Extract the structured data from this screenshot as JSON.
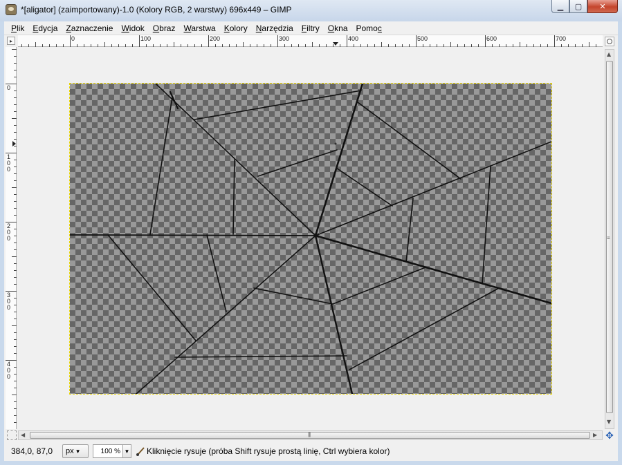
{
  "window": {
    "title": "*[aligator] (zaimportowany)-1.0 (Kolory RGB, 2 warstwy) 696x449 – GIMP",
    "buttons": {
      "minimize": "▁",
      "maximize": "▢",
      "close": "✕"
    }
  },
  "menu": [
    {
      "key": "P",
      "rest": "lik"
    },
    {
      "key": "E",
      "rest": "dycja"
    },
    {
      "key": "Z",
      "rest": "aznaczenie"
    },
    {
      "key": "W",
      "rest": "idok"
    },
    {
      "key": "O",
      "rest": "braz"
    },
    {
      "key": "W",
      "rest": "arstwa"
    },
    {
      "key": "K",
      "rest": "olory"
    },
    {
      "key": "N",
      "rest": "arzędzia"
    },
    {
      "key": "F",
      "rest": "iltry"
    },
    {
      "key": "O",
      "rest": "kna"
    },
    {
      "pre": "Pomo",
      "key": "c",
      "rest": ""
    }
  ],
  "ruler": {
    "horizontal_labels": [
      "0",
      "100",
      "200",
      "300",
      "400",
      "500",
      "600",
      "700"
    ],
    "vertical_labels": [
      "0",
      "100",
      "200",
      "300",
      "400"
    ]
  },
  "statusbar": {
    "coords": "384,0, 87,0",
    "unit": "px",
    "zoom": "100 %",
    "message": "Kliknięcie rysuje (próba Shift rysuje prostą linię, Ctrl wybiera kolor)"
  },
  "colors": {
    "checker_dark": "#666666",
    "checker_light": "#999999",
    "stroke": "#111111",
    "selection_border": "#e8d400"
  },
  "icons": {
    "app": "gimp-icon",
    "paintbrush": "paintbrush-icon",
    "navigate": "navigate-icon",
    "zoom_image": "zoom-icon"
  }
}
